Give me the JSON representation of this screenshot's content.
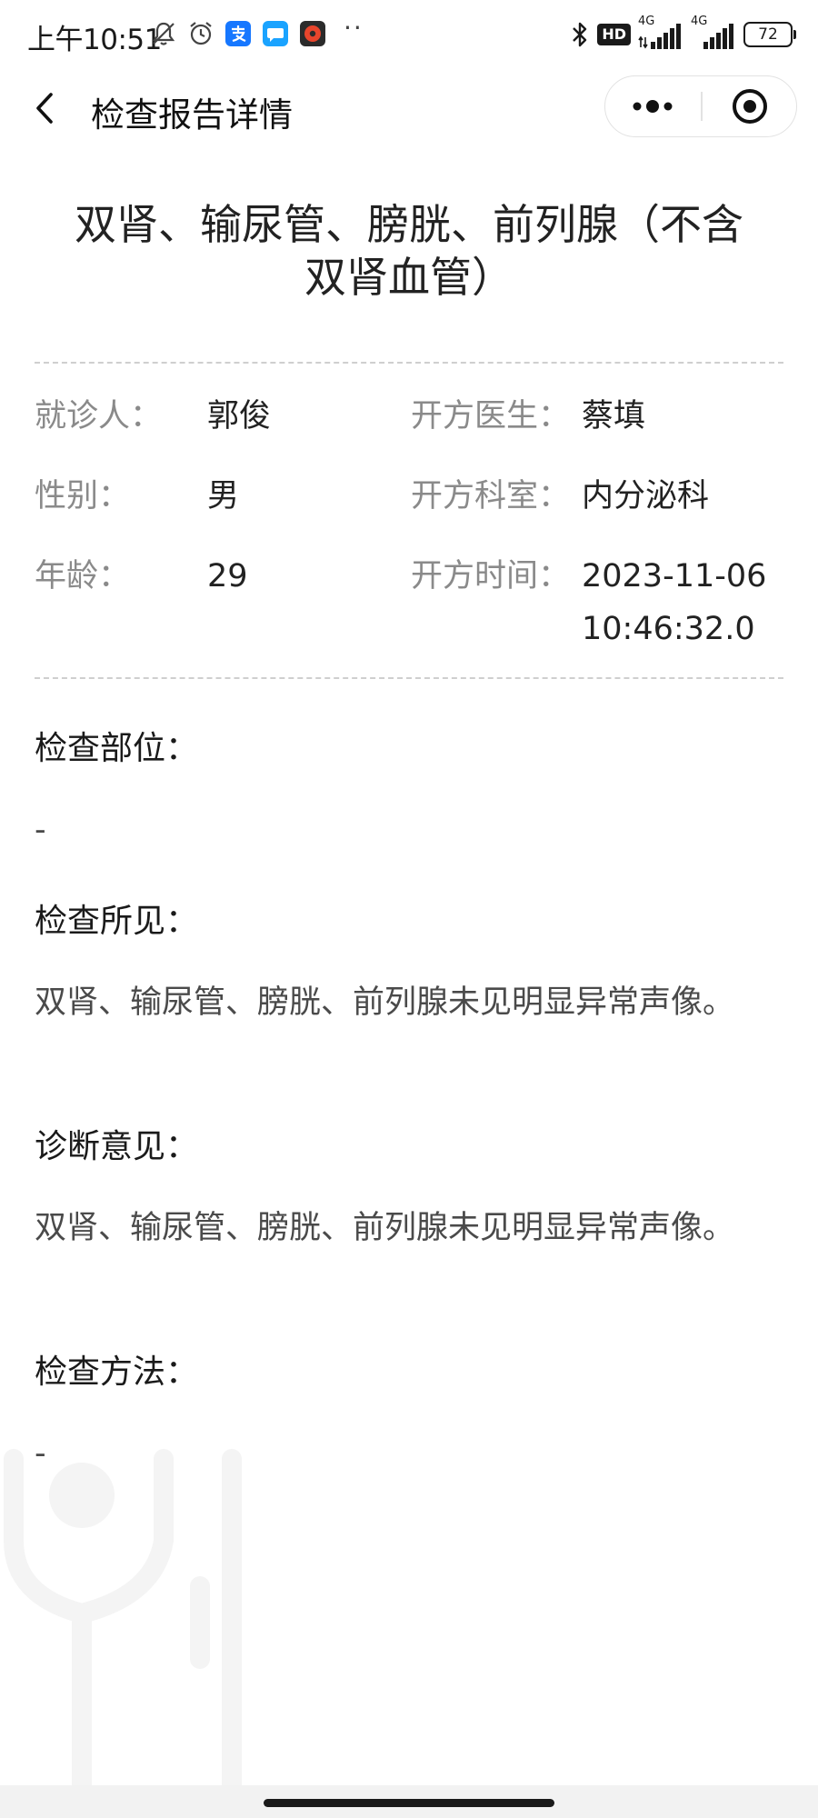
{
  "status_bar": {
    "time": "上午10:51",
    "hd_label": "HD",
    "network_1": "4G",
    "network_2": "4G",
    "battery": "72"
  },
  "nav": {
    "title": "检查报告详情"
  },
  "report": {
    "title": "双肾、输尿管、膀胱、前列腺（不含双肾血管）"
  },
  "patient_info": {
    "patient_label": "就诊人：",
    "patient_name": "郭俊",
    "gender_label": "性别：",
    "gender": "男",
    "age_label": "年龄：",
    "age": "29",
    "doctor_label": "开方医生：",
    "doctor": "蔡填",
    "department_label": "开方科室：",
    "department": "内分泌科",
    "time_label": "开方时间：",
    "prescription_date": "2023-11-06",
    "prescription_time": "10:46:32.0"
  },
  "sections": {
    "site_title": "检查部位：",
    "site_value": "-",
    "findings_title": "检查所见：",
    "findings_value": "双肾、输尿管、膀胱、前列腺未见明显异常声像。",
    "diagnosis_title": "诊断意见：",
    "diagnosis_value": "双肾、输尿管、膀胱、前列腺未见明显异常声像。",
    "method_title": "检查方法：",
    "method_value": "-"
  }
}
